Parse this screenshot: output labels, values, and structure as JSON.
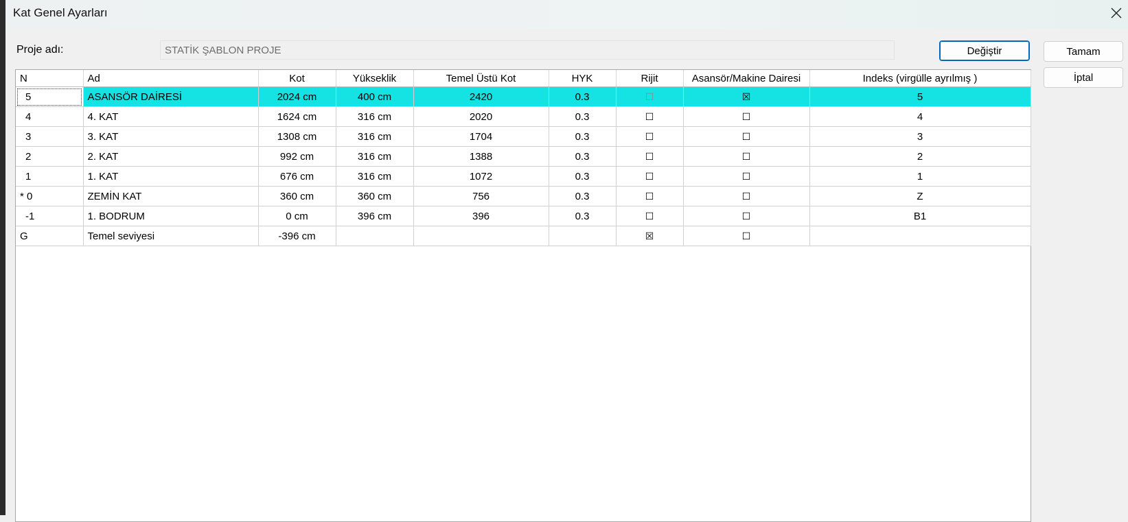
{
  "window": {
    "title": "Kat Genel Ayarları"
  },
  "project": {
    "label": "Proje adı:",
    "value": "STATİK ŞABLON PROJE"
  },
  "buttons": {
    "change": "Değiştir",
    "ok": "Tamam",
    "cancel": "İptal"
  },
  "table": {
    "headers": [
      "N",
      "Ad",
      "Kot",
      "Yükseklik",
      "Temel Üstü Kot",
      "HYK",
      "Rijit",
      "Asansör/Makine Dairesi",
      "Indeks (virgülle ayrılmış )"
    ],
    "rows": [
      {
        "n": "5",
        "ad": "ASANSÖR DAİRESİ",
        "kot": "2024 cm",
        "yukseklik": "400 cm",
        "temel": "2420",
        "hyk": "0.3",
        "rijit": "☐",
        "asansor": "☒",
        "indeks": "5",
        "selected": true
      },
      {
        "n": "4",
        "ad": "4. KAT",
        "kot": "1624 cm",
        "yukseklik": "316 cm",
        "temel": "2020",
        "hyk": "0.3",
        "rijit": "☐",
        "asansor": "☐",
        "indeks": "4"
      },
      {
        "n": "3",
        "ad": "3. KAT",
        "kot": "1308 cm",
        "yukseklik": "316 cm",
        "temel": "1704",
        "hyk": "0.3",
        "rijit": "☐",
        "asansor": "☐",
        "indeks": "3"
      },
      {
        "n": "2",
        "ad": "2. KAT",
        "kot": "992 cm",
        "yukseklik": "316 cm",
        "temel": "1388",
        "hyk": "0.3",
        "rijit": "☐",
        "asansor": "☐",
        "indeks": "2"
      },
      {
        "n": "1",
        "ad": "1. KAT",
        "kot": "676 cm",
        "yukseklik": "316 cm",
        "temel": "1072",
        "hyk": "0.3",
        "rijit": "☐",
        "asansor": "☐",
        "indeks": "1"
      },
      {
        "n": "* 0",
        "ad": "ZEMİN KAT",
        "kot": "360 cm",
        "yukseklik": "360 cm",
        "temel": "756",
        "hyk": "0.3",
        "rijit": "☐",
        "asansor": "☐",
        "indeks": "Z"
      },
      {
        "n": "-1",
        "ad": "1. BODRUM",
        "kot": "0 cm",
        "yukseklik": "396 cm",
        "temel": "396",
        "hyk": "0.3",
        "rijit": "☐",
        "asansor": "☐",
        "indeks": "B1"
      },
      {
        "n": "G",
        "ad": "Temel seviyesi",
        "kot": "-396 cm",
        "yukseklik": "",
        "temel": "",
        "hyk": "",
        "rijit": "☒",
        "asansor": "☐",
        "indeks": ""
      }
    ]
  },
  "colors": {
    "selected_row": "#15e2e2",
    "focus_button_border": "#0067c0"
  },
  "icons": {
    "close": "close-icon"
  }
}
